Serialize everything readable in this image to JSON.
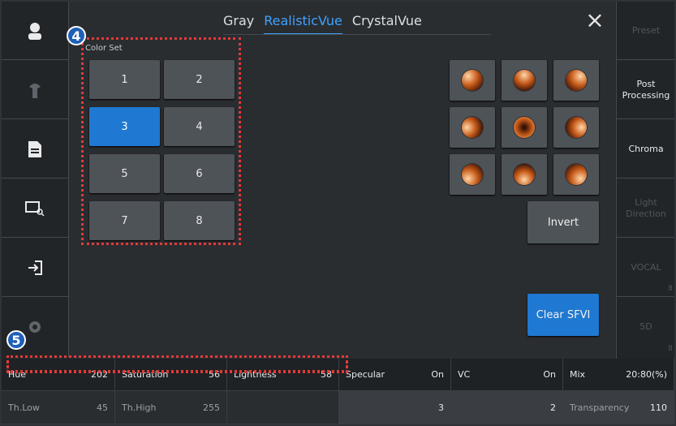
{
  "tabs": [
    "Gray",
    "RealisticVue",
    "CrystalVue"
  ],
  "active_tab_index": 1,
  "close_icon": "close-icon",
  "color_set": {
    "label": "Color Set",
    "buttons": [
      "1",
      "2",
      "3",
      "4",
      "5",
      "6",
      "7",
      "8"
    ],
    "selected": "3"
  },
  "light_direction_buttons": [
    "light-top-left",
    "light-top",
    "light-top-right",
    "light-left",
    "light-center",
    "light-right",
    "light-bottom-left",
    "light-bottom",
    "light-bottom-right"
  ],
  "invert_label": "Invert",
  "clear_label": "Clear SFVI",
  "annotations": {
    "badge_4": "4",
    "badge_5": "5"
  },
  "left_sidebar": [
    "patient-icon",
    "probe-icon",
    "report-icon",
    "review-icon",
    "exit-icon",
    "settings-icon"
  ],
  "right_sidebar": [
    {
      "label": "Preset",
      "active": false
    },
    {
      "label": "Post Processing",
      "active": true
    },
    {
      "label": "Chroma",
      "active": true
    },
    {
      "label": "Light Direction",
      "active": false
    },
    {
      "label": "VOCAL",
      "active": false
    },
    {
      "label": "5D",
      "active": false
    }
  ],
  "params_row1": [
    {
      "label": "Hue",
      "value": "202"
    },
    {
      "label": "Saturation",
      "value": "56"
    },
    {
      "label": "Lightness",
      "value": "58"
    },
    {
      "label": "Specular",
      "value": "On"
    },
    {
      "label": "VC",
      "value": "On"
    },
    {
      "label": "Mix",
      "value": "20:80(%)"
    }
  ],
  "params_row2": [
    {
      "label": "Th.Low",
      "value": "45"
    },
    {
      "label": "Th.High",
      "value": "255"
    },
    {
      "label": "",
      "value": ""
    },
    {
      "label": "",
      "value": "3"
    },
    {
      "label": "",
      "value": "2"
    },
    {
      "label": "Transparency",
      "value": "110"
    }
  ],
  "colors": {
    "accent": "#1f78d1",
    "annotation": "#e23a3a"
  }
}
